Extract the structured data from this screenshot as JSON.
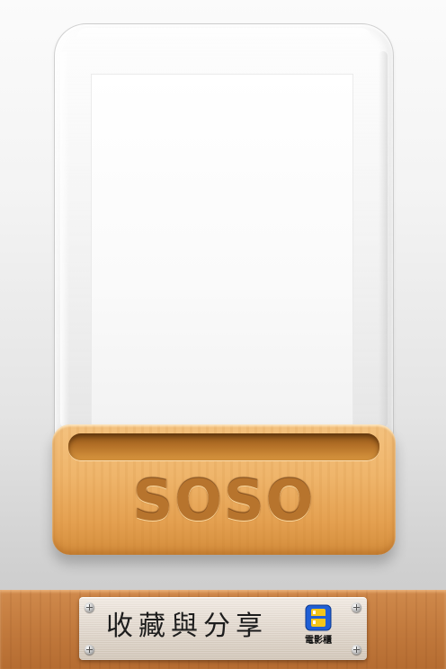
{
  "display_case": {
    "logo_text": "SOSO"
  },
  "nameplate": {
    "title": "收藏與分享",
    "brand_label": "電影櫃",
    "brand_icon": "film-cabinet-icon"
  },
  "colors": {
    "wood_light": "#f4c27f",
    "wood_dark": "#d38c3b",
    "shelf_wood": "#c27a3d",
    "logo_engrave": "#b7742d",
    "brand_icon_blue": "#1f5fd6",
    "brand_icon_yellow": "#f3c61a"
  }
}
